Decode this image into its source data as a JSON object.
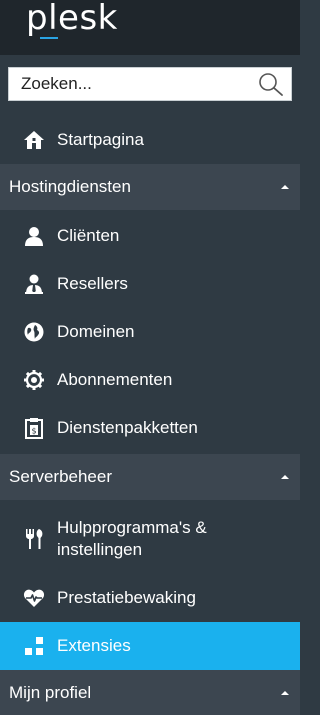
{
  "brand": {
    "logo_text": "plesk"
  },
  "search": {
    "placeholder": "Zoeken..."
  },
  "nav": {
    "home": {
      "label": "Startpagina"
    },
    "sections": [
      {
        "title": "Hostingdiensten",
        "items": [
          {
            "label": "Cliënten"
          },
          {
            "label": "Resellers"
          },
          {
            "label": "Domeinen"
          },
          {
            "label": "Abonnementen"
          },
          {
            "label": "Dienstenpakketten"
          }
        ]
      },
      {
        "title": "Serverbeheer",
        "items": [
          {
            "label_line1": "Hulpprogramma's &",
            "label_line2": "instellingen"
          },
          {
            "label": "Prestatiebewaking"
          },
          {
            "label": "Extensies",
            "active": true
          }
        ]
      },
      {
        "title": "Mijn profiel",
        "items": []
      }
    ]
  },
  "colors": {
    "sidebar_bg": "#2f3a43",
    "topbar_bg": "#1f262c",
    "section_bg": "#3c4650",
    "active_bg": "#1ab1ee",
    "accent": "#2aa3e3"
  }
}
